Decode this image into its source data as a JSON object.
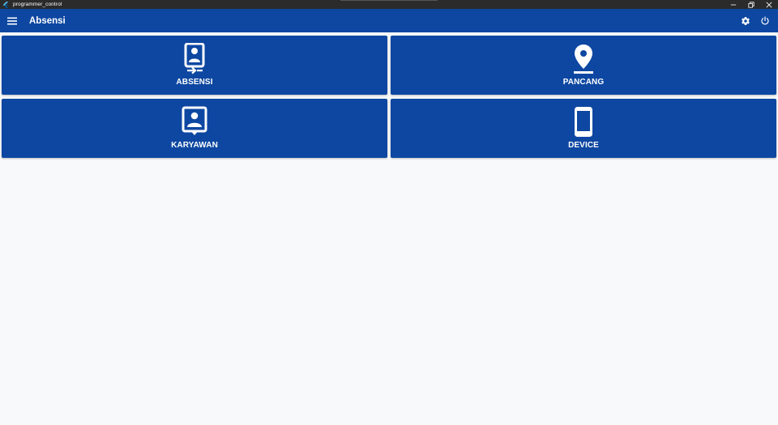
{
  "window": {
    "title": "programmer_control",
    "app_icon": "flutter-icon",
    "buttons": [
      "minimize-icon",
      "restore-icon",
      "close-icon"
    ]
  },
  "appbar": {
    "title": "Absensi",
    "menu_icon": "hamburger-menu-icon",
    "settings_icon": "gear-icon",
    "power_icon": "power-icon",
    "color": "#0d47a1"
  },
  "tiles": [
    {
      "label": "ABSENSI",
      "icon": "badge-login-icon"
    },
    {
      "label": "PANCANG",
      "icon": "location-pin-icon"
    },
    {
      "label": "KARYAWAN",
      "icon": "employee-portrait-icon"
    },
    {
      "label": "DEVICE",
      "icon": "smartphone-icon"
    }
  ],
  "colors": {
    "tile": "#0d47a1",
    "background": "#f8f9fa",
    "titlebar": "#2b2b2b"
  }
}
